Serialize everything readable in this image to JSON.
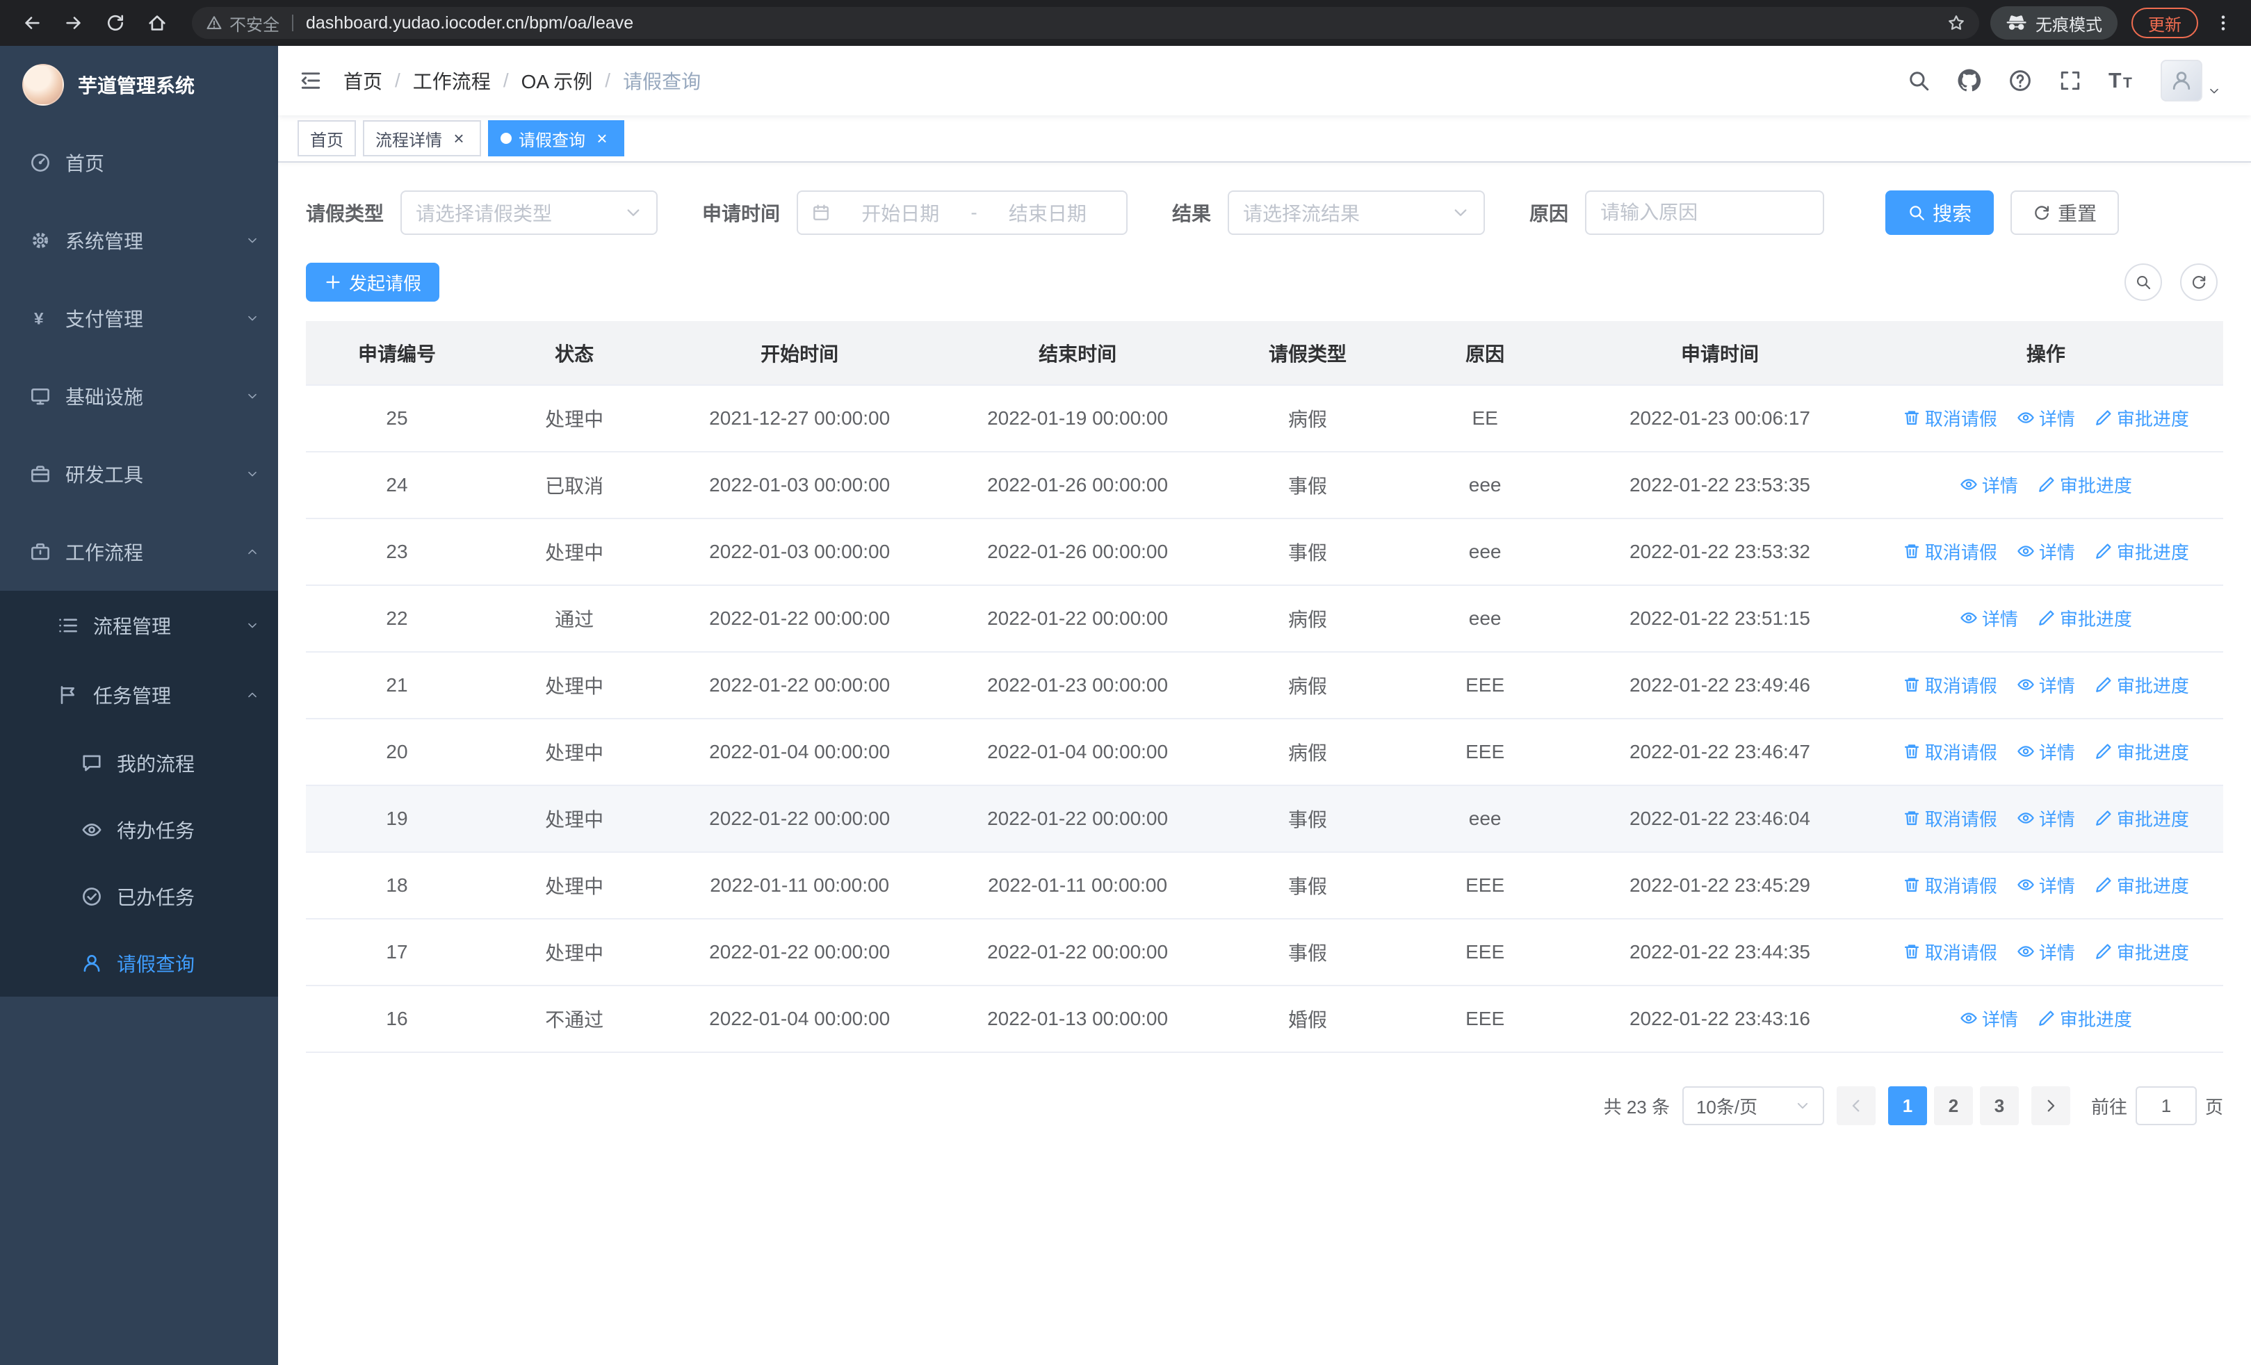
{
  "theme": {
    "accent": "#409EFF",
    "sidebar_bg": "#304156",
    "submenu_bg": "#1f2d3d"
  },
  "browser": {
    "security_warning": "不安全",
    "url": "dashboard.yudao.iocoder.cn/bpm/oa/leave",
    "incognito_label": "无痕模式",
    "update_label": "更新"
  },
  "sidebar": {
    "logo_title": "芋道管理系统",
    "items": [
      {
        "key": "home",
        "label": "首页",
        "icon": "dashboard",
        "icon_name": "dashboard-icon",
        "level": 1
      },
      {
        "key": "system",
        "label": "系统管理",
        "icon": "gear",
        "icon_name": "gear-icon",
        "level": 1,
        "expandable": true
      },
      {
        "key": "payment",
        "label": "支付管理",
        "icon": "yen",
        "icon_name": "yen-icon",
        "level": 1,
        "expandable": true
      },
      {
        "key": "infrastructure",
        "label": "基础设施",
        "icon": "monitor",
        "icon_name": "monitor-icon",
        "level": 1,
        "expandable": true
      },
      {
        "key": "dev-tools",
        "label": "研发工具",
        "icon": "briefcase",
        "icon_name": "briefcase-icon",
        "level": 1,
        "expandable": true
      },
      {
        "key": "workflow",
        "label": "工作流程",
        "icon": "workflow",
        "icon_name": "workflow-icon",
        "level": 1,
        "expandable": true,
        "expanded": true
      },
      {
        "key": "process-mgmt",
        "label": "流程管理",
        "icon": "list",
        "icon_name": "list-icon",
        "level": 2,
        "expandable": true
      },
      {
        "key": "task-mgmt",
        "label": "任务管理",
        "icon": "flag",
        "icon_name": "flag-icon",
        "level": 2,
        "expandable": true,
        "expanded": true
      },
      {
        "key": "my-process",
        "label": "我的流程",
        "icon": "chat",
        "icon_name": "chat-icon",
        "level": 3
      },
      {
        "key": "todo-task",
        "label": "待办任务",
        "icon": "eye",
        "icon_name": "eye-icon",
        "level": 3
      },
      {
        "key": "done-task",
        "label": "已办任务",
        "icon": "check",
        "icon_name": "check-icon",
        "level": 3
      },
      {
        "key": "leave-query",
        "label": "请假查询",
        "icon": "user",
        "icon_name": "user-icon",
        "level": 3,
        "active": true
      }
    ]
  },
  "header": {
    "breadcrumb": [
      "首页",
      "工作流程",
      "OA 示例",
      "请假查询"
    ],
    "separator": "/"
  },
  "tabs": [
    {
      "key": "home",
      "label": "首页",
      "active": false,
      "closable": false
    },
    {
      "key": "process-detail",
      "label": "流程详情",
      "active": false,
      "closable": true
    },
    {
      "key": "leave-query",
      "label": "请假查询",
      "active": true,
      "closable": true
    }
  ],
  "filters": {
    "leave_type_label": "请假类型",
    "leave_type_placeholder": "请选择请假类型",
    "apply_time_label": "申请时间",
    "start_date_placeholder": "开始日期",
    "range_separator": "-",
    "end_date_placeholder": "结束日期",
    "result_label": "结果",
    "result_placeholder": "请选择流结果",
    "reason_label": "原因",
    "reason_placeholder": "请输入原因",
    "search_label": "搜索",
    "reset_label": "重置"
  },
  "toolbar": {
    "create_label": "发起请假"
  },
  "table": {
    "columns": [
      "申请编号",
      "状态",
      "开始时间",
      "结束时间",
      "请假类型",
      "原因",
      "申请时间",
      "操作"
    ],
    "action_defs": {
      "cancel": {
        "label": "取消请假",
        "icon": "trash",
        "icon_name": "delete-icon",
        "name": "cancel-leave-link"
      },
      "detail": {
        "label": "详情",
        "icon": "eye",
        "icon_name": "view-icon",
        "name": "detail-link"
      },
      "progress": {
        "label": "审批进度",
        "icon": "pen",
        "icon_name": "edit-icon",
        "name": "approval-progress-link"
      }
    },
    "rows": [
      {
        "id": "25",
        "status": "处理中",
        "start": "2021-12-27 00:00:00",
        "end": "2022-01-19 00:00:00",
        "type": "病假",
        "reason": "EE",
        "apply_time": "2022-01-23 00:06:17",
        "actions": [
          "cancel",
          "detail",
          "progress"
        ]
      },
      {
        "id": "24",
        "status": "已取消",
        "start": "2022-01-03 00:00:00",
        "end": "2022-01-26 00:00:00",
        "type": "事假",
        "reason": "eee",
        "apply_time": "2022-01-22 23:53:35",
        "actions": [
          "detail",
          "progress"
        ]
      },
      {
        "id": "23",
        "status": "处理中",
        "start": "2022-01-03 00:00:00",
        "end": "2022-01-26 00:00:00",
        "type": "事假",
        "reason": "eee",
        "apply_time": "2022-01-22 23:53:32",
        "actions": [
          "cancel",
          "detail",
          "progress"
        ]
      },
      {
        "id": "22",
        "status": "通过",
        "start": "2022-01-22 00:00:00",
        "end": "2022-01-22 00:00:00",
        "type": "病假",
        "reason": "eee",
        "apply_time": "2022-01-22 23:51:15",
        "actions": [
          "detail",
          "progress"
        ]
      },
      {
        "id": "21",
        "status": "处理中",
        "start": "2022-01-22 00:00:00",
        "end": "2022-01-23 00:00:00",
        "type": "病假",
        "reason": "EEE",
        "apply_time": "2022-01-22 23:49:46",
        "actions": [
          "cancel",
          "detail",
          "progress"
        ]
      },
      {
        "id": "20",
        "status": "处理中",
        "start": "2022-01-04 00:00:00",
        "end": "2022-01-04 00:00:00",
        "type": "病假",
        "reason": "EEE",
        "apply_time": "2022-01-22 23:46:47",
        "actions": [
          "cancel",
          "detail",
          "progress"
        ]
      },
      {
        "id": "19",
        "status": "处理中",
        "start": "2022-01-22 00:00:00",
        "end": "2022-01-22 00:00:00",
        "type": "事假",
        "reason": "eee",
        "apply_time": "2022-01-22 23:46:04",
        "actions": [
          "cancel",
          "detail",
          "progress"
        ],
        "highlighted": true
      },
      {
        "id": "18",
        "status": "处理中",
        "start": "2022-01-11 00:00:00",
        "end": "2022-01-11 00:00:00",
        "type": "事假",
        "reason": "EEE",
        "apply_time": "2022-01-22 23:45:29",
        "actions": [
          "cancel",
          "detail",
          "progress"
        ]
      },
      {
        "id": "17",
        "status": "处理中",
        "start": "2022-01-22 00:00:00",
        "end": "2022-01-22 00:00:00",
        "type": "事假",
        "reason": "EEE",
        "apply_time": "2022-01-22 23:44:35",
        "actions": [
          "cancel",
          "detail",
          "progress"
        ]
      },
      {
        "id": "16",
        "status": "不通过",
        "start": "2022-01-04 00:00:00",
        "end": "2022-01-13 00:00:00",
        "type": "婚假",
        "reason": "EEE",
        "apply_time": "2022-01-22 23:43:16",
        "actions": [
          "detail",
          "progress"
        ]
      }
    ]
  },
  "pagination": {
    "total_text": "共 23 条",
    "page_size_text": "10条/页",
    "pages": [
      "1",
      "2",
      "3"
    ],
    "active_page": "1",
    "goto_prefix": "前往",
    "goto_value": "1",
    "goto_suffix": "页"
  },
  "icons": {
    "back-icon": "back",
    "forward-icon": "forward",
    "reload-icon": "reload",
    "home-icon": "home",
    "warning-icon": "warning",
    "bookmark-star-icon": "star",
    "incognito-icon": "incognito",
    "kebab-menu-icon": "kebab",
    "hamburger-icon": "fold",
    "search-icon": "magnifier",
    "github-icon": "github",
    "help-icon": "question",
    "fullscreen-icon": "fullscreen",
    "font-size-icon": "fontsize",
    "caret-down-icon": "chevron-down",
    "select-arrow-icon": "chevron-down",
    "calendar-icon": "calendar",
    "search-button-icon": "magnifier",
    "reset-icon": "refresh",
    "plus-icon": "plus",
    "toolbar-search-icon": "magnifier",
    "toolbar-refresh-icon": "refresh",
    "prev-icon": "chevron-left",
    "next-icon": "chevron-right",
    "avatar-placeholder-icon": "user",
    "close-icon": "close"
  }
}
